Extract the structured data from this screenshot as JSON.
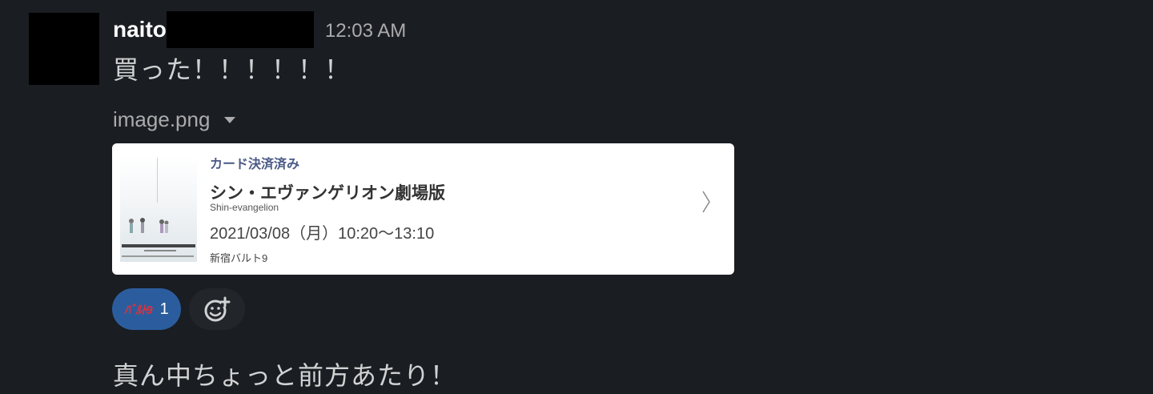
{
  "message": {
    "author": "naito",
    "timestamp": "12:03 AM",
    "text": "買った！！！！！！",
    "followup_text": "真ん中ちょっと前方あたり！"
  },
  "attachment": {
    "filename": "image.png",
    "card": {
      "status": "カード決済済み",
      "title": "シン・エヴァンゲリオン劇場版",
      "title_en": "Shin-evangelion",
      "datetime": "2021/03/08（月）10:20〜13:10",
      "venue": "新宿バルト9"
    }
  },
  "reactions": [
    {
      "emoji_text": "ﾊﾞﾙﾄ9",
      "count": "1"
    }
  ],
  "colors": {
    "background": "#1a1d21",
    "reaction_active": "#2b5d9e",
    "card_status": "#4b5a86"
  }
}
